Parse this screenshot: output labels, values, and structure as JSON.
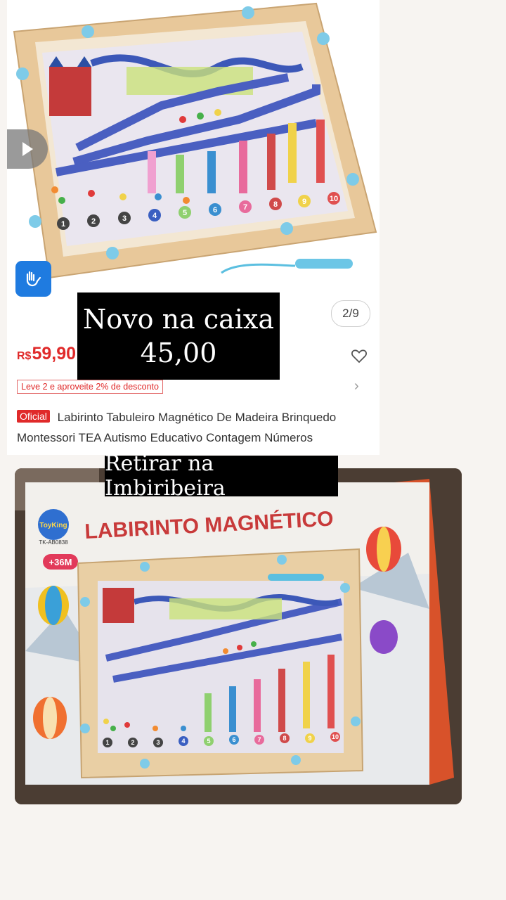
{
  "listing": {
    "page_indicator": "2/9",
    "old_price_currency": "R$",
    "old_price_value": "59,90",
    "promo": "Leve 2 e aproveite 2% de desconto",
    "badge": "Oficial",
    "title": "Labirinto Tabuleiro Magnético De Madeira Brinquedo Montessori TEA Autismo Educativo Contagem Números",
    "board_numbers": [
      "1",
      "2",
      "3",
      "4",
      "5",
      "6",
      "7",
      "8",
      "9",
      "10"
    ]
  },
  "overlay": {
    "line1": "Novo na caixa",
    "line2": "45,00"
  },
  "photo": {
    "caption": "Retirar na Imbiribeira",
    "box_title": "LABIRINTO MAGNÉTICO",
    "brand": "ToyKing",
    "model": "TK-AB0838",
    "age": "+36M"
  },
  "icons": {
    "play": "play-icon",
    "accessibility": "sign-language-icon",
    "favorite": "heart-icon",
    "next": "chevron-right-icon"
  },
  "colors": {
    "price_red": "#e02a2a",
    "access_blue": "#1f7be0"
  }
}
